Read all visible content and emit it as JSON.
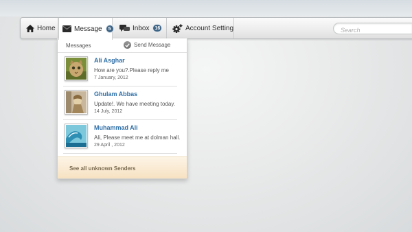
{
  "nav": {
    "home_label": "Home",
    "message_label": "Message",
    "message_count": "5",
    "inbox_label": "Inbox",
    "inbox_count": "16",
    "account_label": "Account Setting"
  },
  "search": {
    "placeholder": "Search"
  },
  "dropdown": {
    "title": "Messages",
    "send_label": "Send Message",
    "items": [
      {
        "name": "Ali Asghar",
        "text": "How are you?.Please reply me",
        "date": "7 January, 2012"
      },
      {
        "name": "Ghulam Abbas",
        "text": "Update!. We have meeting today.",
        "date": "14 July, 2012"
      },
      {
        "name": "Muhammad Ali",
        "text": "Ali, Please meet me at dolman hall.",
        "date": "29 April , 2012"
      }
    ],
    "see_all": "See all unknown Senders"
  },
  "colors": {
    "accent": "#3e6486",
    "link": "#2f6fa7",
    "footer": "#f7e2c2"
  },
  "icons": [
    "home-icon",
    "envelope-icon",
    "chat-bubbles-icon",
    "gear-icon",
    "check-icon"
  ]
}
